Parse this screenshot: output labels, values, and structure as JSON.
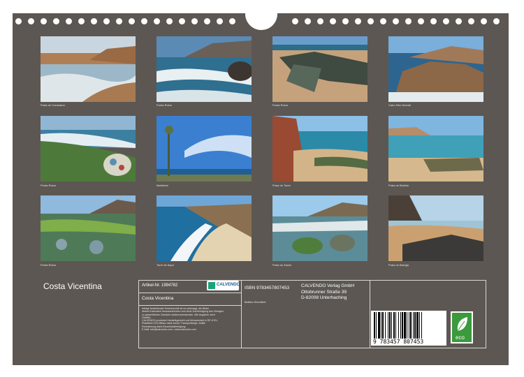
{
  "calendar": {
    "title": "Costa Vicentina",
    "photos": [
      {
        "caption": "Praia do Cordoama"
      },
      {
        "caption": "Punta Ruiva"
      },
      {
        "caption": "Punta Ruiva"
      },
      {
        "caption": "Cabo São Vicente"
      },
      {
        "caption": "Punta Ruiva"
      },
      {
        "caption": "Martinhal"
      },
      {
        "caption": "Praia do Tonel"
      },
      {
        "caption": "Praia do Beliche"
      },
      {
        "caption": "Punta Ruiva"
      },
      {
        "caption": "Torre de Aspa"
      },
      {
        "caption": "Praia do Zavial"
      },
      {
        "caption": "Praia do Barriga"
      }
    ]
  },
  "info": {
    "article_label": "Artikel-Nr. 1994782",
    "calendar_name": "Costa Vicentina",
    "publisher_logo": "CALVENDO",
    "legal_text": [
      "Infolge bestehender Schutzrechte ist es untersagt, die Bilder",
      "dieses Kalenders herauszutrennen und ohne Genehmigung des Verlages",
      "zu gewerblichen Zwecken weiterzuverwenden. Alle Angaben ohne",
      "Gewähr.",
      "CALVENDO produziert bedarfsgerecht und klimaneutral in DE & EU.",
      "Plastikfrei CO2-Bilanz dank kurzer Transportwege. Abfall-",
      "Reduzierung dank Einzelstückfertigung.",
      "E-Mail: info@calvendo.com • www.calvendo.com"
    ],
    "isbn": "ISBN 9783457807453",
    "author": "Bettina Schnittert",
    "publisher": [
      "CALVENDO Verlag GmbH",
      "Ottobrunner Straße 39",
      "D-82008 Unterhaching"
    ],
    "barcode_number": "9 783457 807453",
    "eco_label": "eco"
  }
}
